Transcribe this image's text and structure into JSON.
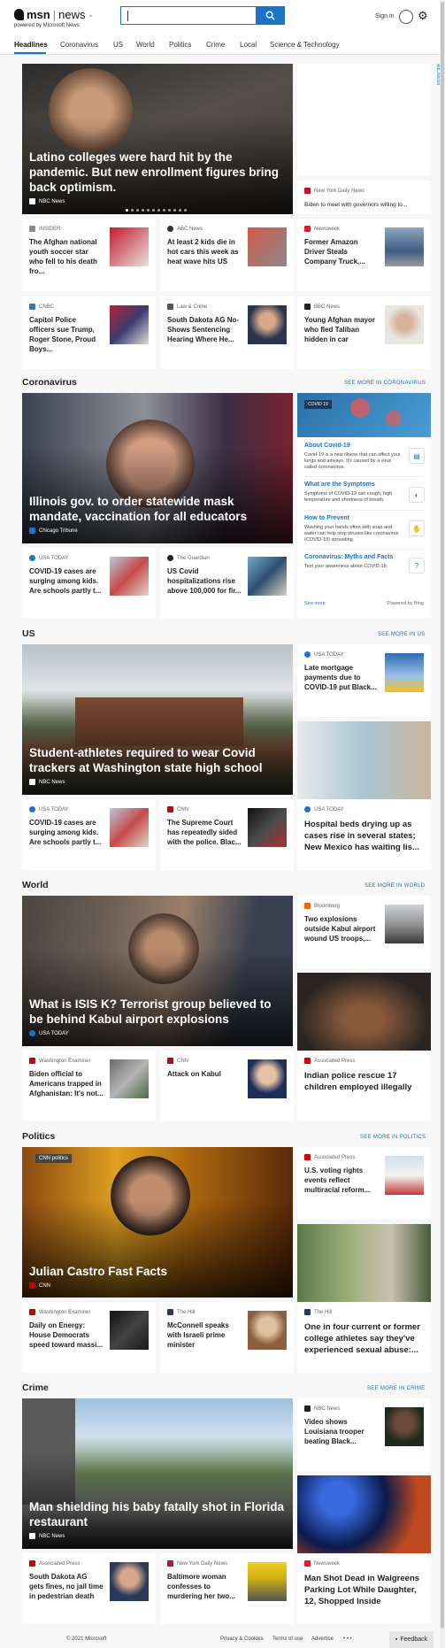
{
  "header": {
    "brand": "msn",
    "section": "news",
    "powered_by": "powered by Microsoft News",
    "sign_in": "Sign in"
  },
  "nav": [
    "Headlines",
    "Coronavirus",
    "US",
    "World",
    "Politics",
    "Crime",
    "Local",
    "Science & Technology"
  ],
  "adchoices": "AdChoices",
  "hero1": {
    "title": "Latino colleges were hard hit by the pandemic. But new enrollment figures bring back optimism.",
    "source": "NBC News"
  },
  "top_side": {
    "source": "New York Daily News",
    "title": "Biden to meet with governors willing to..."
  },
  "top_row1": [
    {
      "source": "INSIDER",
      "title": "The Afghan national youth soccer star who fell to his death fro..."
    },
    {
      "source": "ABC News",
      "title": "At least 2 kids die in hot cars this week as heat wave hits US"
    },
    {
      "source": "Newsweek",
      "title": "Former Amazon Driver Steals Company Truck,..."
    }
  ],
  "top_row2": [
    {
      "source": "CNBC",
      "title": "Capitol Police officers sue Trump, Roger Stone, Proud Boys..."
    },
    {
      "source": "Law & Crime",
      "title": "South Dakota AG No-Shows Sentencing Hearing Where He..."
    },
    {
      "source": "BBC News",
      "title": "Young Afghan mayor who fled Taliban hidden in car"
    }
  ],
  "coronavirus": {
    "heading": "Coronavirus",
    "more": "SEE MORE IN CORONAVIRUS",
    "hero": {
      "title": "Illinois gov. to order statewide mask mandate, vaccination for all educators",
      "source": "Chicago Tribune"
    },
    "cards": [
      {
        "source": "USA TODAY",
        "title": "COVID-19 cases are surging among kids. Are schools partly t..."
      },
      {
        "source": "The Guardian",
        "title": "US Covid hospitalizations rise above 100,000 for fir..."
      }
    ],
    "widget": {
      "badge": "COVID 19",
      "items": [
        {
          "title": "About Covid-19",
          "desc": "Covid-19 is a new illness that can affect your lungs and airways. It's caused by a virus called coronavirus."
        },
        {
          "title": "What are the Symptoms",
          "desc": "Symptoms of COVID-19 can cough, high temperature and shortness of breath."
        },
        {
          "title": "How to Prevent",
          "desc": "Washing your hands often with soap and water can help stop viruses like coronavirus (COVID-19) spreading."
        },
        {
          "title": "Coronavirus: Myths and Facts",
          "desc": "Test your awareness about COVID-19."
        }
      ],
      "see_more": "See more",
      "powered": "Powered by Bing"
    }
  },
  "us": {
    "heading": "US",
    "more": "SEE MORE IN US",
    "hero": {
      "title": "Student-athletes required to wear Covid trackers at Washington state high school",
      "source": "NBC News"
    },
    "side_top": {
      "source": "USA TODAY",
      "title": "Late mortgage payments due to COVID-19 put Black..."
    },
    "cards": [
      {
        "source": "USA TODAY",
        "title": "COVID-19 cases are surging among kids. Are schools partly t..."
      },
      {
        "source": "CNN",
        "title": "The Supreme Court has repeatedly sided with the police. Blac..."
      }
    ],
    "side_big": {
      "source": "USA TODAY",
      "title": "Hospital beds drying up as cases rise in several states; New Mexico has waiting lis..."
    }
  },
  "world": {
    "heading": "World",
    "more": "SEE MORE IN WORLD",
    "hero": {
      "title": "What is ISIS K? Terrorist group believed to be behind Kabul airport explosions",
      "source": "USA TODAY"
    },
    "side_top": {
      "source": "Bloomberg",
      "title": "Two explosions outside Kabul airport wound US troops,..."
    },
    "cards": [
      {
        "source": "Washington Examiner",
        "title": "Biden official to Americans trapped in Afghanistan: It's not..."
      },
      {
        "source": "CNN",
        "title": "Attack on Kabul"
      }
    ],
    "side_big": {
      "source": "Associated Press",
      "title": "Indian police rescue 17 children employed illegally"
    }
  },
  "politics": {
    "heading": "Politics",
    "more": "SEE MORE IN POLITICS",
    "hero": {
      "title": "Julian Castro Fast Facts",
      "source": "CNN",
      "tag": "CNN politics"
    },
    "side_top": {
      "source": "Associated Press",
      "title": "U.S. voting rights events reflect multiracial reform..."
    },
    "cards": [
      {
        "source": "Washington Examiner",
        "title": "Daily on Energy: House Democrats speed toward massi..."
      },
      {
        "source": "The Hill",
        "title": "McConnell speaks with Israeli prime minister"
      }
    ],
    "side_big": {
      "source": "The Hill",
      "title": "One in four current or former college athletes say they've experienced sexual abuse:..."
    }
  },
  "crime": {
    "heading": "Crime",
    "more": "SEE MORE IN CRIME",
    "hero": {
      "title": "Man shielding his baby fatally shot in Florida restaurant",
      "source": "NBC News"
    },
    "side_top": {
      "source": "NBC News",
      "title": "Video shows Louisiana trooper beating Black..."
    },
    "cards": [
      {
        "source": "Associated Press",
        "title": "South Dakota AG gets fines, no jail time in pedestrian death"
      },
      {
        "source": "New York Daily News",
        "title": "Baltimore woman confesses to murdering her two..."
      }
    ],
    "side_big": {
      "source": "Newsweek",
      "title": "Man Shot Dead in Walgreens Parking Lot While Daughter, 12, Shopped Inside"
    }
  },
  "footer": {
    "copyright": "© 2021 Microsoft",
    "privacy": "Privacy & Cookies",
    "terms": "Terms of use",
    "advertise": "Advertise",
    "dots": "• • •",
    "feedback": "Feedback"
  }
}
